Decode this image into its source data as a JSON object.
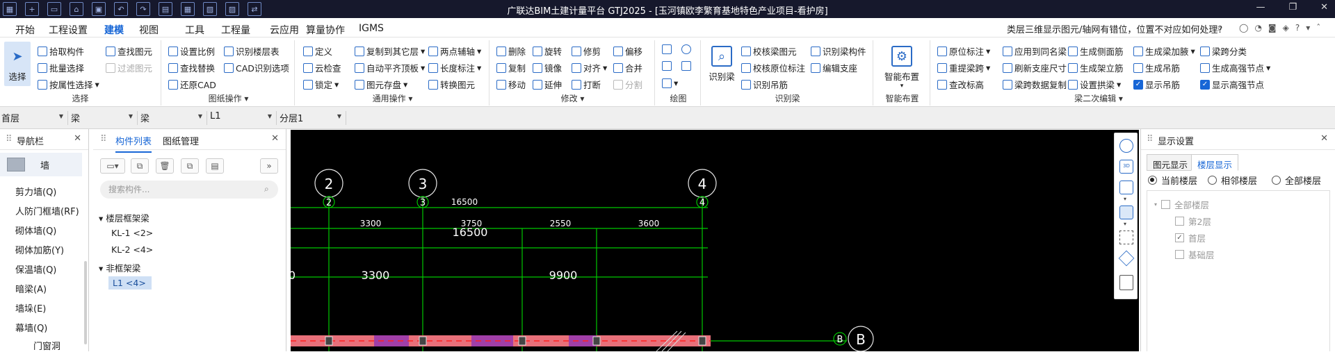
{
  "title": "广联达BIM土建计量平台 GTJ2025 - [玉河镇欧李繁育基地特色产业项目-看护房]",
  "menu": {
    "tabs": [
      "开始",
      "工程设置",
      "建模",
      "视图",
      "工具",
      "工程量",
      "云应用",
      "算量协作",
      "IGMS"
    ],
    "active": "建模"
  },
  "help": {
    "text": "类层三维显示图元/轴网有错位，位置不对应如何处理?"
  },
  "ribbon": {
    "select": {
      "big": "选择",
      "items": [
        "拾取构件",
        "批量选择",
        "按属性选择"
      ],
      "items2": [
        "查找图元",
        "过滤图元"
      ],
      "group": "选择"
    },
    "drawing": {
      "items": [
        "设置比例",
        "查找替换",
        "还原CAD",
        "识别楼层表",
        "CAD识别选项"
      ],
      "group": "图纸操作"
    },
    "general": {
      "items": [
        "定义",
        "云检查",
        "锁定",
        "复制到其它层",
        "自动平齐顶板",
        "图元存盘",
        "两点辅轴",
        "长度标注",
        "转换图元"
      ],
      "group": "通用操作"
    },
    "modify": {
      "items": [
        "删除",
        "旋转",
        "修剪",
        "偏移",
        "复制",
        "镜像",
        "对齐",
        "合并",
        "移动",
        "延伸",
        "打断",
        "分割"
      ],
      "group": "修改"
    },
    "draw": {
      "group": "绘图"
    },
    "recognize": {
      "big": "识别梁",
      "items": [
        "校核梁图元",
        "识别梁构件",
        "校核原位标注",
        "编辑支座",
        "识别吊筋"
      ],
      "group": "识别梁"
    },
    "smart": {
      "big": "智能布置",
      "group": "智能布置"
    },
    "beam2": {
      "items": [
        "原位标注",
        "应用到同名梁",
        "生成侧面筋",
        "生成梁加腋",
        "梁跨分类",
        "重提梁跨",
        "刷新支座尺寸",
        "生成架立筋",
        "生成吊筋",
        "生成高强节点",
        "查改标高",
        "梁跨数据复制",
        "设置拱梁",
        "显示吊筋",
        "显示高强节点"
      ],
      "group": "梁二次编辑"
    }
  },
  "selectors": [
    "首层",
    "梁",
    "梁",
    "L1",
    "分层1"
  ],
  "nav": {
    "title": "导航栏",
    "category": "墙",
    "items": [
      "剪力墙(Q)",
      "人防门框墙(RF)",
      "砌体墙(Q)",
      "砌体加筋(Y)",
      "保温墙(Q)",
      "暗梁(A)",
      "墙垛(E)",
      "幕墙(Q)",
      "门窗洞"
    ]
  },
  "component": {
    "tabs": [
      "构件列表",
      "图纸管理"
    ],
    "search_placeholder": "搜索构件...",
    "tree": [
      {
        "label": "楼层框架梁",
        "children": [
          "KL-1 <2>",
          "KL-2 <4>"
        ]
      },
      {
        "label": "非框架梁",
        "children": [
          "L1 <4>"
        ]
      }
    ]
  },
  "canvas": {
    "axis_labels": [
      "2",
      "3",
      "4",
      "B",
      "B"
    ],
    "axis_marks": [
      "2",
      "3",
      "4"
    ],
    "dims_top": [
      "16500"
    ],
    "dims_mid": [
      "3300",
      "3750",
      "2550",
      "3600"
    ],
    "dims_total": "16500",
    "dims_large": [
      "0",
      "3300",
      "9900"
    ]
  },
  "display": {
    "title": "显示设置",
    "tabs": [
      "图元显示",
      "楼层显示"
    ],
    "radios": [
      "当前楼层",
      "相邻楼层",
      "全部楼层"
    ],
    "tree": {
      "root": "全部楼层",
      "floors": [
        "第2层",
        "首层",
        "基础层"
      ]
    }
  },
  "colors": {
    "accent": "#1766d6",
    "canvas": "#000000",
    "axis": "#00c800",
    "beam": "#e8707a"
  }
}
